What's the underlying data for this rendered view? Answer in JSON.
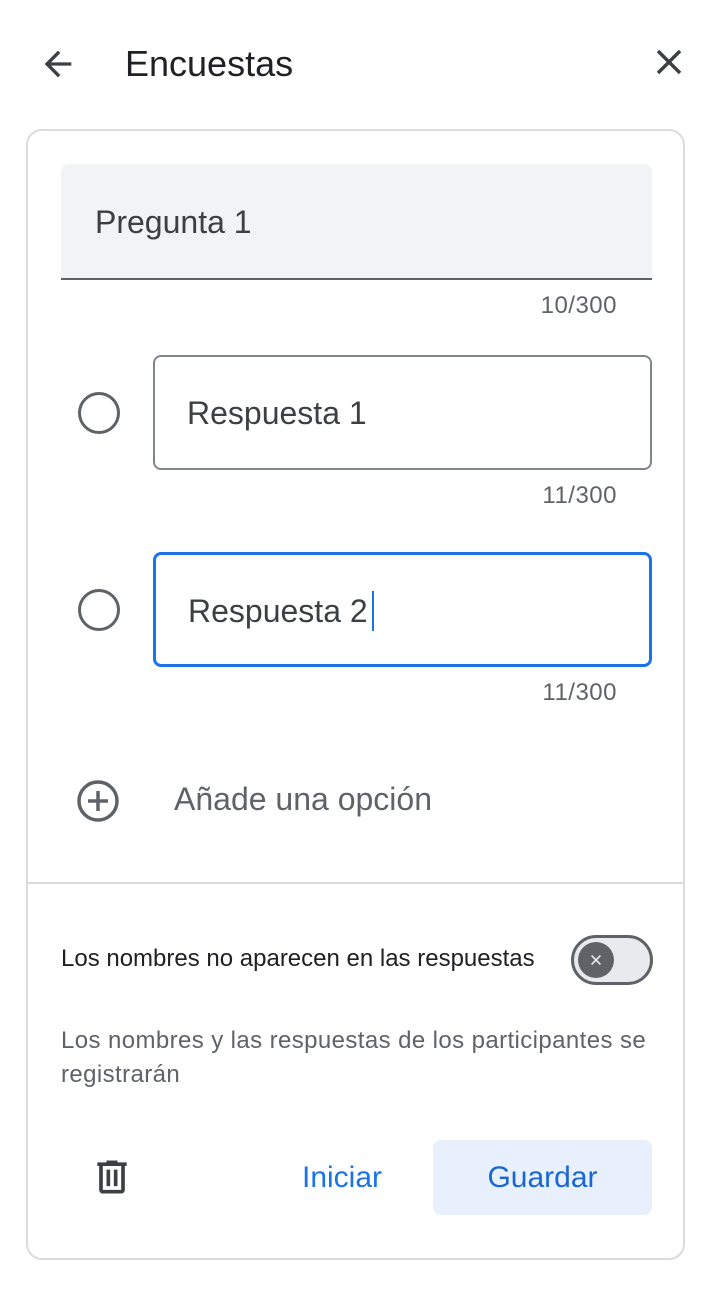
{
  "header": {
    "title": "Encuestas",
    "back_icon": "arrow-back-icon",
    "close_icon": "close-icon"
  },
  "question": {
    "value": "Pregunta 1",
    "counter": "10/300"
  },
  "answers": [
    {
      "value": "Respuesta 1",
      "counter": "11/300",
      "active": false
    },
    {
      "value": "Respuesta 2",
      "counter": "11/300",
      "active": true
    }
  ],
  "add_option": {
    "label": "Añade una opción",
    "icon": "add-circle-icon"
  },
  "anonymous": {
    "label": "Los nombres no aparecen en las respuestas",
    "enabled": false
  },
  "info": {
    "text": "Los nombres y las respuestas de los participantes se registrarán"
  },
  "actions": {
    "delete_icon": "trash-icon",
    "start_label": "Iniciar",
    "save_label": "Guardar"
  },
  "colors": {
    "accent": "#1a73e8",
    "save_bg": "#e8f0fe",
    "field_bg": "#f1f3f4",
    "icon_gray": "#5f6368"
  }
}
